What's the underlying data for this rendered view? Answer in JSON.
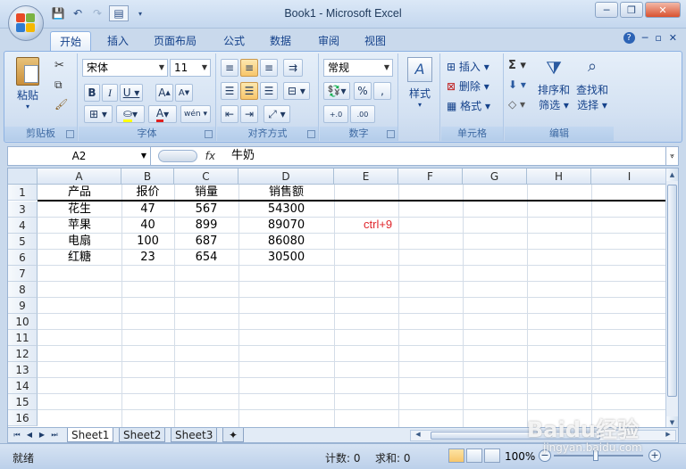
{
  "window": {
    "title": "Book1 - Microsoft Excel"
  },
  "ribbon_tabs": [
    "开始",
    "插入",
    "页面布局",
    "公式",
    "数据",
    "审阅",
    "视图"
  ],
  "ribbon": {
    "clipboard": {
      "label": "剪贴板",
      "paste": "粘贴"
    },
    "font": {
      "label": "字体",
      "font_name": "宋体",
      "font_size": "11"
    },
    "alignment": {
      "label": "对齐方式"
    },
    "number": {
      "label": "数字",
      "format": "常规"
    },
    "styles": {
      "label": "样式"
    },
    "cells": {
      "label": "单元格",
      "insert": "插入",
      "delete": "删除",
      "format": "格式"
    },
    "editing": {
      "label": "编辑",
      "sort_filter_1": "排序和",
      "sort_filter_2": "筛选",
      "find_select_1": "查找和",
      "find_select_2": "选择"
    }
  },
  "formula_bar": {
    "name_box": "A2",
    "fx": "fx",
    "content": "牛奶"
  },
  "columns": [
    "A",
    "B",
    "C",
    "D",
    "E",
    "F",
    "G",
    "H",
    "I"
  ],
  "rows": [
    "1",
    "3",
    "4",
    "5",
    "6",
    "7",
    "8",
    "9",
    "10",
    "11",
    "12",
    "13",
    "14",
    "15",
    "16"
  ],
  "cells": {
    "header": [
      "产品",
      "报价",
      "销量",
      "销售额"
    ],
    "data": [
      [
        "花生",
        "47",
        "567",
        "54300"
      ],
      [
        "苹果",
        "40",
        "899",
        "89070"
      ],
      [
        "电扇",
        "100",
        "687",
        "86080"
      ],
      [
        "红糖",
        "23",
        "654",
        "30500"
      ]
    ]
  },
  "annotation": "ctrl+9",
  "sheet_tabs": [
    "Sheet1",
    "Sheet2",
    "Sheet3"
  ],
  "status": {
    "ready": "就绪",
    "count": "计数: 0",
    "sum": "求和: 0",
    "zoom": "100%"
  },
  "watermark": {
    "main": "Baidu经验",
    "sub": "jingyan.baidu.com"
  }
}
